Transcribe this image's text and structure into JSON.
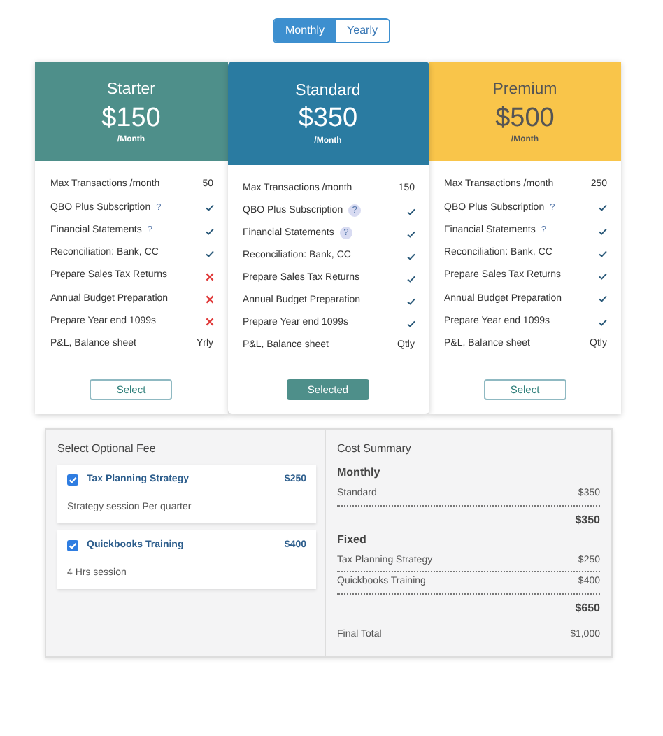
{
  "billing_toggle": [
    {
      "label": "Monthly",
      "selected": true
    },
    {
      "label": "Yearly",
      "selected": false
    }
  ],
  "plans": [
    {
      "name": "Starter",
      "price": "$150",
      "period": "/Month",
      "color": "#4e8f8a",
      "selected": false,
      "button": "Select",
      "features": [
        {
          "label": "Max Transactions /month",
          "kind": "text",
          "value": "50"
        },
        {
          "label": "QBO Plus Subscription",
          "help": "?",
          "kind": "check"
        },
        {
          "label": "Financial Statements",
          "help": "?",
          "kind": "check"
        },
        {
          "label": "Reconciliation: Bank, CC",
          "kind": "check"
        },
        {
          "label": "Prepare Sales Tax Returns",
          "kind": "cross"
        },
        {
          "label": "Annual Budget Preparation",
          "kind": "cross"
        },
        {
          "label": "Prepare Year end 1099s",
          "kind": "cross"
        },
        {
          "label": "P&L, Balance sheet",
          "kind": "text",
          "value": "Yrly"
        }
      ]
    },
    {
      "name": "Standard",
      "price": "$350",
      "period": "/Month",
      "color": "#2a7ba1",
      "selected": true,
      "button": "Selected",
      "features": [
        {
          "label": "Max Transactions /month",
          "kind": "text",
          "value": "150"
        },
        {
          "label": "QBO Plus Subscription",
          "help": "?",
          "kind": "check"
        },
        {
          "label": "Financial Statements",
          "help": "?",
          "kind": "check"
        },
        {
          "label": "Reconciliation: Bank, CC",
          "kind": "check"
        },
        {
          "label": "Prepare Sales Tax Returns",
          "kind": "check"
        },
        {
          "label": "Annual Budget Preparation",
          "kind": "check"
        },
        {
          "label": "Prepare Year end 1099s",
          "kind": "check"
        },
        {
          "label": "P&L, Balance sheet",
          "kind": "text",
          "value": "Qtly"
        }
      ]
    },
    {
      "name": "Premium",
      "price": "$500",
      "period": "/Month",
      "color": "#f9c54a",
      "selected": false,
      "button": "Select",
      "features": [
        {
          "label": "Max Transactions /month",
          "kind": "text",
          "value": "250"
        },
        {
          "label": "QBO Plus Subscription",
          "help": "?",
          "kind": "check"
        },
        {
          "label": "Financial Statements",
          "help": "?",
          "kind": "check"
        },
        {
          "label": "Reconciliation: Bank, CC",
          "kind": "check"
        },
        {
          "label": "Prepare Sales Tax Returns",
          "kind": "check"
        },
        {
          "label": "Annual Budget Preparation",
          "kind": "check"
        },
        {
          "label": "Prepare Year end 1099s",
          "kind": "check"
        },
        {
          "label": "P&L, Balance sheet",
          "kind": "text",
          "value": "Qtly"
        }
      ]
    }
  ],
  "optional_fees": {
    "title": "Select Optional Fee",
    "items": [
      {
        "name": "Tax Planning Strategy",
        "price": "$250",
        "description": "Strategy session Per quarter",
        "checked": true
      },
      {
        "name": "Quickbooks Training",
        "price": "$400",
        "description": "4 Hrs session",
        "checked": true
      }
    ]
  },
  "cost_summary": {
    "title": "Cost Summary",
    "sections": [
      {
        "heading": "Monthly",
        "lines": [
          {
            "label": "Standard",
            "amount": "$350"
          }
        ],
        "subtotal": "$350"
      },
      {
        "heading": "Fixed",
        "lines": [
          {
            "label": "Tax Planning Strategy",
            "amount": "$250"
          },
          {
            "label": "Quickbooks Training",
            "amount": "$400"
          }
        ],
        "subtotal": "$650"
      }
    ],
    "final": {
      "label": "Final Total",
      "amount": "$1,000"
    }
  }
}
